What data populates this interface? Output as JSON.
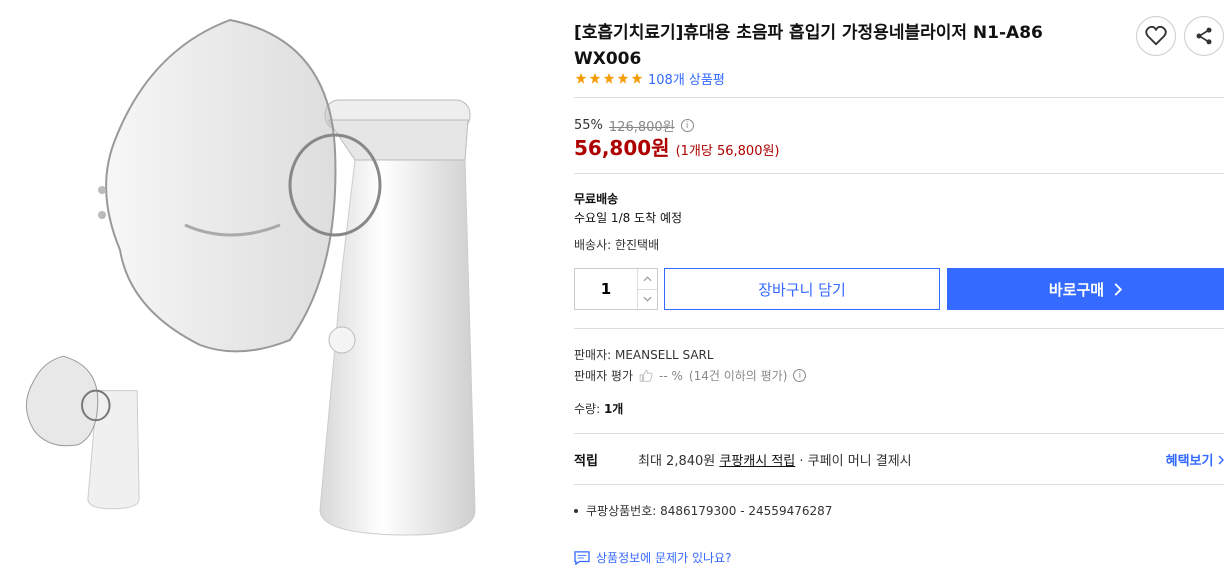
{
  "product": {
    "title": "[호흡기치료기]휴대용 초음파 흡입기 가정용네블라이저 N1-A86 WX006",
    "review_count_text": "108개 상품평",
    "rating_stars": 5
  },
  "pricing": {
    "discount_pct": "55%",
    "original_price": "126,800원",
    "price": "56,800원",
    "unit_price": "(1개당 56,800원)"
  },
  "shipping": {
    "free_label": "무료배송",
    "arrival": "수요일 1/8 도착 예정",
    "courier": "배송사: 한진택배"
  },
  "purchase": {
    "quantity": "1",
    "cart_label": "장바구니 담기",
    "buy_label": "바로구매"
  },
  "seller": {
    "name_line": "판매자: MEANSELL SARL",
    "rating_label": "판매자 평가",
    "rating_value": "-- %",
    "rating_note": "(14건 이하의 평가)",
    "qty_label": "수량:",
    "qty_value": "1개"
  },
  "reward": {
    "title": "적립",
    "text_before": "최대 2,840원",
    "link": "쿠팡캐시 적립",
    "text_after": "· 쿠페이 머니 결제시",
    "benefit_link": "혜택보기"
  },
  "details": {
    "product_no": "쿠팡상품번호: 8486179300 - 24559476287",
    "report_link": "상품정보에 문제가 있나요?"
  },
  "colors": {
    "accent": "#346aff",
    "price": "#ae0000",
    "star": "#f59e0b"
  }
}
